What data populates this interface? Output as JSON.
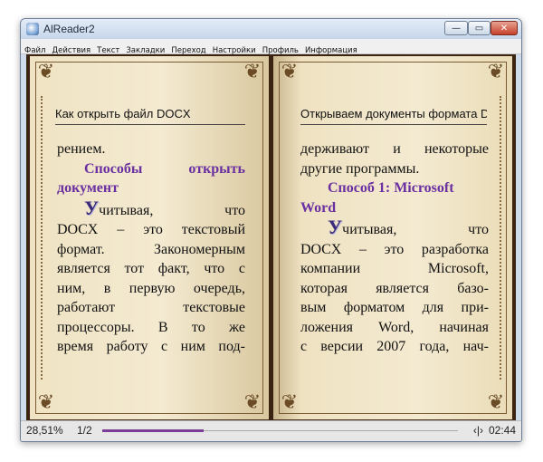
{
  "window": {
    "title": "AlReader2",
    "buttons": {
      "minimize": "—",
      "maximize": "▭",
      "close": "✕"
    }
  },
  "menu": [
    "Файл",
    "Действия",
    "Текст",
    "Закладки",
    "Переход",
    "Настройки",
    "Профиль",
    "Информация"
  ],
  "left_page": {
    "header": "Как открыть файл DOCX",
    "lines": [
      "рением."
    ],
    "heading": [
      "Способы открыть",
      "документ"
    ],
    "dropcap": "У",
    "para_first": "читывая, что",
    "para_lines": [
      "DOCX – это текстовый",
      "формат. Закономерным",
      "является тот факт, что с",
      "ним, в первую очередь,",
      "работают текстовые",
      "процессоры. В то же",
      "время работу с ним под-"
    ]
  },
  "right_page": {
    "header": "Открываем документы формата DO...",
    "lines": [
      "держивают и некоторые",
      "другие программы."
    ],
    "heading": [
      "Способ 1: Microsoft",
      "Word"
    ],
    "dropcap": "У",
    "para_first": "читывая, что",
    "para_lines": [
      "DOCX – это разработка",
      "компании Microsoft,",
      "которая является базо-",
      "вым форматом для при-",
      "ложения Word, начиная",
      "с версии 2007 года, нач-"
    ]
  },
  "status": {
    "percent": "28,51%",
    "pages": "1/2",
    "progress": 0.2851,
    "nav": "‹|›",
    "time": "02:44"
  }
}
